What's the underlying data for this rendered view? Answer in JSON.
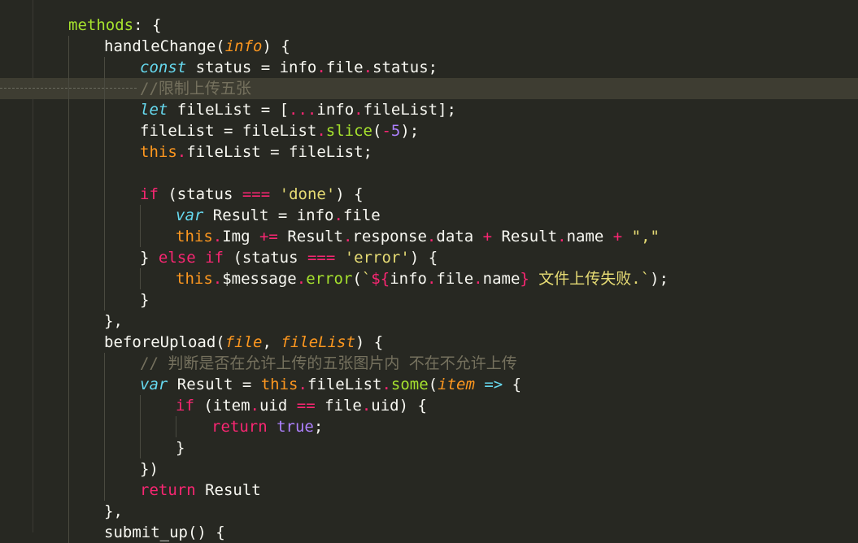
{
  "editor": {
    "lines": [
      {
        "indent": 1,
        "tokens": [
          [
            "fn",
            "methods"
          ],
          [
            "pl",
            ": {"
          ]
        ]
      },
      {
        "indent": 2,
        "tokens": [
          [
            "pl",
            "handleChange("
          ],
          [
            "pm",
            "info"
          ],
          [
            "pl",
            ") {"
          ]
        ]
      },
      {
        "indent": 3,
        "tokens": [
          [
            "st",
            "const"
          ],
          [
            "pl",
            " status = info"
          ],
          [
            "dt",
            "."
          ],
          [
            "pl",
            "file"
          ],
          [
            "dt",
            "."
          ],
          [
            "pl",
            "status;"
          ]
        ]
      },
      {
        "indent": 3,
        "current": true,
        "tokens": [
          [
            "cm",
            "//限制上传五张"
          ]
        ]
      },
      {
        "indent": 3,
        "tokens": [
          [
            "st",
            "let"
          ],
          [
            "pl",
            " fileList = ["
          ],
          [
            "kw",
            "..."
          ],
          [
            "pl",
            "info"
          ],
          [
            "dt",
            "."
          ],
          [
            "pl",
            "fileList];"
          ]
        ]
      },
      {
        "indent": 3,
        "tokens": [
          [
            "pl",
            "fileList = fileList"
          ],
          [
            "dt",
            "."
          ],
          [
            "fn",
            "slice"
          ],
          [
            "pl",
            "("
          ],
          [
            "kw",
            "-"
          ],
          [
            "num",
            "5"
          ],
          [
            "pl",
            ");"
          ]
        ]
      },
      {
        "indent": 3,
        "tokens": [
          [
            "this",
            "this"
          ],
          [
            "dt",
            "."
          ],
          [
            "pl",
            "fileList = fileList;"
          ]
        ]
      },
      {
        "indent": 3,
        "tokens": []
      },
      {
        "indent": 3,
        "tokens": [
          [
            "kw",
            "if"
          ],
          [
            "pl",
            " (status "
          ],
          [
            "kw",
            "==="
          ],
          [
            "pl",
            " "
          ],
          [
            "str",
            "'done'"
          ],
          [
            "pl",
            ") {"
          ]
        ]
      },
      {
        "indent": 4,
        "tokens": [
          [
            "st",
            "var"
          ],
          [
            "pl",
            " Result = info"
          ],
          [
            "dt",
            "."
          ],
          [
            "pl",
            "file"
          ]
        ]
      },
      {
        "indent": 4,
        "tokens": [
          [
            "this",
            "this"
          ],
          [
            "dt",
            "."
          ],
          [
            "pl",
            "Img "
          ],
          [
            "kw",
            "+="
          ],
          [
            "pl",
            " Result"
          ],
          [
            "dt",
            "."
          ],
          [
            "pl",
            "response"
          ],
          [
            "dt",
            "."
          ],
          [
            "pl",
            "data "
          ],
          [
            "kw",
            "+"
          ],
          [
            "pl",
            " Result"
          ],
          [
            "dt",
            "."
          ],
          [
            "pl",
            "name "
          ],
          [
            "kw",
            "+"
          ],
          [
            "pl",
            " "
          ],
          [
            "str",
            "\",\""
          ]
        ]
      },
      {
        "indent": 3,
        "tokens": [
          [
            "pl",
            "} "
          ],
          [
            "kw",
            "else"
          ],
          [
            "pl",
            " "
          ],
          [
            "kw",
            "if"
          ],
          [
            "pl",
            " (status "
          ],
          [
            "kw",
            "==="
          ],
          [
            "pl",
            " "
          ],
          [
            "str",
            "'error'"
          ],
          [
            "pl",
            ") {"
          ]
        ]
      },
      {
        "indent": 4,
        "tokens": [
          [
            "this",
            "this"
          ],
          [
            "dt",
            "."
          ],
          [
            "pl",
            "$message"
          ],
          [
            "dt",
            "."
          ],
          [
            "fn",
            "error"
          ],
          [
            "pl",
            "("
          ],
          [
            "str",
            "`"
          ],
          [
            "kw",
            "${"
          ],
          [
            "pl",
            "info"
          ],
          [
            "dt",
            "."
          ],
          [
            "pl",
            "file"
          ],
          [
            "dt",
            "."
          ],
          [
            "pl",
            "name"
          ],
          [
            "kw",
            "}"
          ],
          [
            "str",
            " 文件上传失败.`"
          ],
          [
            "pl",
            ");"
          ]
        ]
      },
      {
        "indent": 3,
        "tokens": [
          [
            "pl",
            "}"
          ]
        ]
      },
      {
        "indent": 2,
        "tokens": [
          [
            "pl",
            "},"
          ]
        ]
      },
      {
        "indent": 2,
        "tokens": [
          [
            "pl",
            "beforeUpload("
          ],
          [
            "pm",
            "file"
          ],
          [
            "pl",
            ", "
          ],
          [
            "pm",
            "fileList"
          ],
          [
            "pl",
            ") {"
          ]
        ]
      },
      {
        "indent": 3,
        "tokens": [
          [
            "cm",
            "// 判断是否在允许上传的五张图片内 不在不允许上传"
          ]
        ]
      },
      {
        "indent": 3,
        "tokens": [
          [
            "st",
            "var"
          ],
          [
            "pl",
            " Result = "
          ],
          [
            "this",
            "this"
          ],
          [
            "dt",
            "."
          ],
          [
            "pl",
            "fileList"
          ],
          [
            "dt",
            "."
          ],
          [
            "fn",
            "some"
          ],
          [
            "pl",
            "("
          ],
          [
            "pm",
            "item"
          ],
          [
            "pl",
            " "
          ],
          [
            "st",
            "=>"
          ],
          [
            "pl",
            " {"
          ]
        ]
      },
      {
        "indent": 4,
        "tokens": [
          [
            "kw",
            "if"
          ],
          [
            "pl",
            " (item"
          ],
          [
            "dt",
            "."
          ],
          [
            "pl",
            "uid "
          ],
          [
            "kw",
            "=="
          ],
          [
            "pl",
            " file"
          ],
          [
            "dt",
            "."
          ],
          [
            "pl",
            "uid) {"
          ]
        ]
      },
      {
        "indent": 5,
        "tokens": [
          [
            "kw",
            "return"
          ],
          [
            "pl",
            " "
          ],
          [
            "bool",
            "true"
          ],
          [
            "pl",
            ";"
          ]
        ]
      },
      {
        "indent": 4,
        "tokens": [
          [
            "pl",
            "}"
          ]
        ]
      },
      {
        "indent": 3,
        "tokens": [
          [
            "pl",
            "})"
          ]
        ]
      },
      {
        "indent": 3,
        "tokens": [
          [
            "kw",
            "return"
          ],
          [
            "pl",
            " Result"
          ]
        ]
      },
      {
        "indent": 2,
        "tokens": [
          [
            "pl",
            "},"
          ]
        ]
      },
      {
        "indent": 2,
        "tokens": [
          [
            "pl",
            "submit_up() {"
          ]
        ]
      }
    ]
  },
  "colors": {
    "background": "#272822",
    "current_line": "#3e3d32",
    "keyword": "#f92672",
    "storage": "#66d9ef",
    "parameter": "#fd971f",
    "function": "#a6e22e",
    "string": "#e6db74",
    "number": "#ae81ff",
    "comment": "#75715e"
  }
}
